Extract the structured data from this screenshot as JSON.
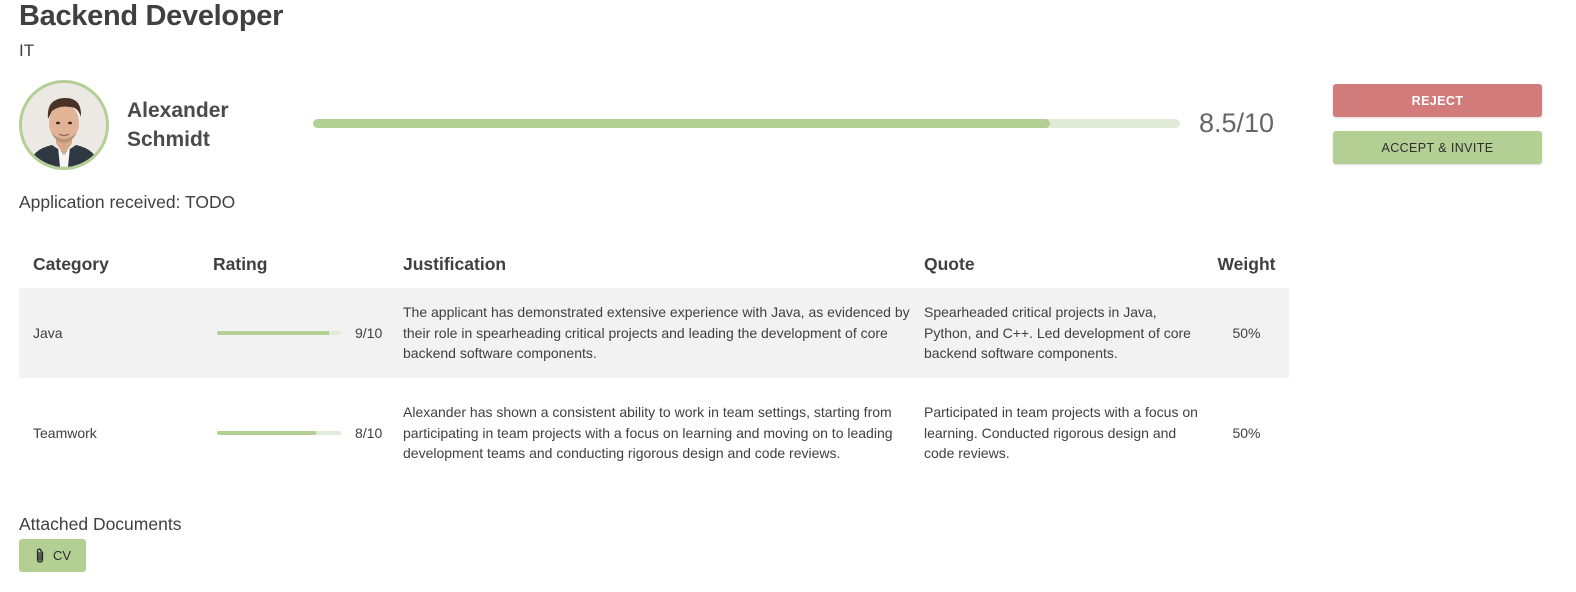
{
  "job": {
    "title": "Backend Developer",
    "department": "IT"
  },
  "candidate": {
    "name_first": "Alexander",
    "name_last": "Schmidt",
    "score_text": "8.5/10",
    "score_fraction": 0.85
  },
  "actions": {
    "reject_label": "REJECT",
    "accept_label": "ACCEPT & INVITE"
  },
  "application": {
    "received_text": "Application received: TODO"
  },
  "table": {
    "headers": {
      "category": "Category",
      "rating": "Rating",
      "justification": "Justification",
      "quote": "Quote",
      "weight": "Weight"
    },
    "rows": [
      {
        "category": "Java",
        "rating_text": "9/10",
        "rating_fraction": 0.9,
        "justification": "The applicant has demonstrated extensive experience with Java, as evidenced by their role in spearheading critical projects and leading the development of core backend software components.",
        "quote": "Spearheaded critical projects in Java, Python, and C++. Led development of core backend software components.",
        "weight": "50%"
      },
      {
        "category": "Teamwork",
        "rating_text": "8/10",
        "rating_fraction": 0.8,
        "justification": "Alexander has shown a consistent ability to work in team settings, starting from participating in team projects with a focus on learning and moving on to leading development teams and conducting rigorous design and code reviews.",
        "quote": "Participated in team projects with a focus on learning. Conducted rigorous design and code reviews.",
        "weight": "50%"
      }
    ]
  },
  "documents": {
    "label": "Attached Documents",
    "items": [
      {
        "label": "CV",
        "icon": "paperclip-icon"
      }
    ]
  },
  "colors": {
    "accent_green": "#b3cf94",
    "track_green": "#e2ebd8",
    "reject_red": "#d17b7b",
    "row_gray": "#f2f2f2"
  }
}
